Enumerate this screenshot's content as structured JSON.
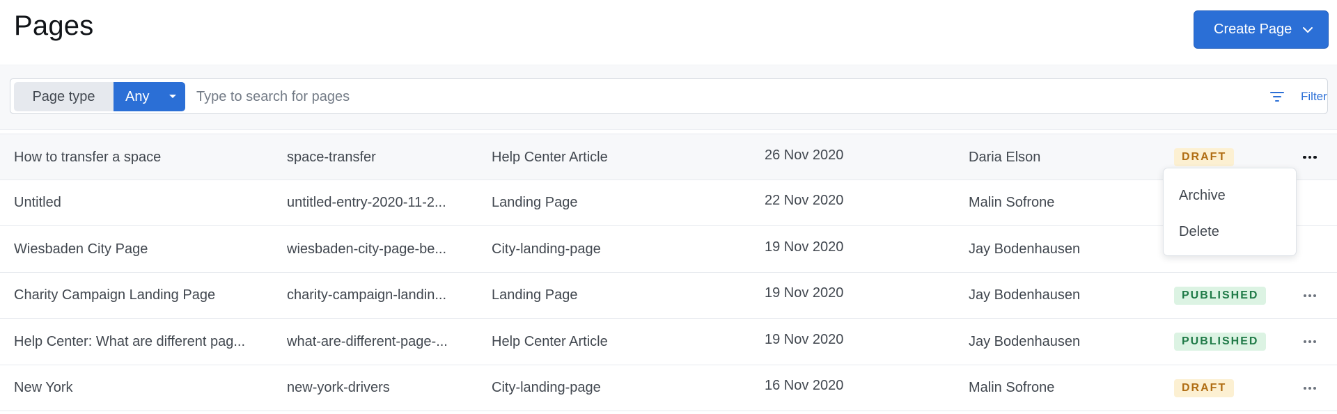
{
  "header": {
    "title": "Pages",
    "create_button": "Create Page"
  },
  "filter": {
    "page_type_label": "Page type",
    "page_type_value": "Any",
    "search_placeholder": "Type to search for pages",
    "filter_label": "Filter"
  },
  "rows": [
    {
      "title": "How to transfer a space",
      "slug": "space-transfer",
      "type": "Help Center Article",
      "date": "26 Nov 2020",
      "author": "Daria Elson",
      "status": "DRAFT"
    },
    {
      "title": "Untitled",
      "slug": "untitled-entry-2020-11-2...",
      "type": "Landing Page",
      "date": "22 Nov 2020",
      "author": "Malin Sofrone",
      "status": ""
    },
    {
      "title": "Wiesbaden City Page",
      "slug": "wiesbaden-city-page-be...",
      "type": "City-landing-page",
      "date": "19 Nov 2020",
      "author": "Jay Bodenhausen",
      "status": ""
    },
    {
      "title": "Charity Campaign Landing Page",
      "slug": "charity-campaign-landin...",
      "type": "Landing Page",
      "date": "19 Nov 2020",
      "author": "Jay Bodenhausen",
      "status": "PUBLISHED"
    },
    {
      "title": "Help Center: What are different pag...",
      "slug": "what-are-different-page-...",
      "type": "Help Center Article",
      "date": "19 Nov 2020",
      "author": "Jay Bodenhausen",
      "status": "PUBLISHED"
    },
    {
      "title": "New York",
      "slug": "new-york-drivers",
      "type": "City-landing-page",
      "date": "16 Nov 2020",
      "author": "Malin Sofrone",
      "status": "DRAFT"
    }
  ],
  "row_menu": {
    "archive": "Archive",
    "delete": "Delete"
  },
  "colors": {
    "accent": "#2b6fd6",
    "draft_bg": "#fcf0d2",
    "draft_text": "#b06d13",
    "published_bg": "#dcf3e3",
    "published_text": "#1f7a47"
  },
  "icons": {
    "create_chevron": "chevron-down-icon",
    "filter": "filter-icon",
    "row_actions": "more-horizontal-icon"
  }
}
